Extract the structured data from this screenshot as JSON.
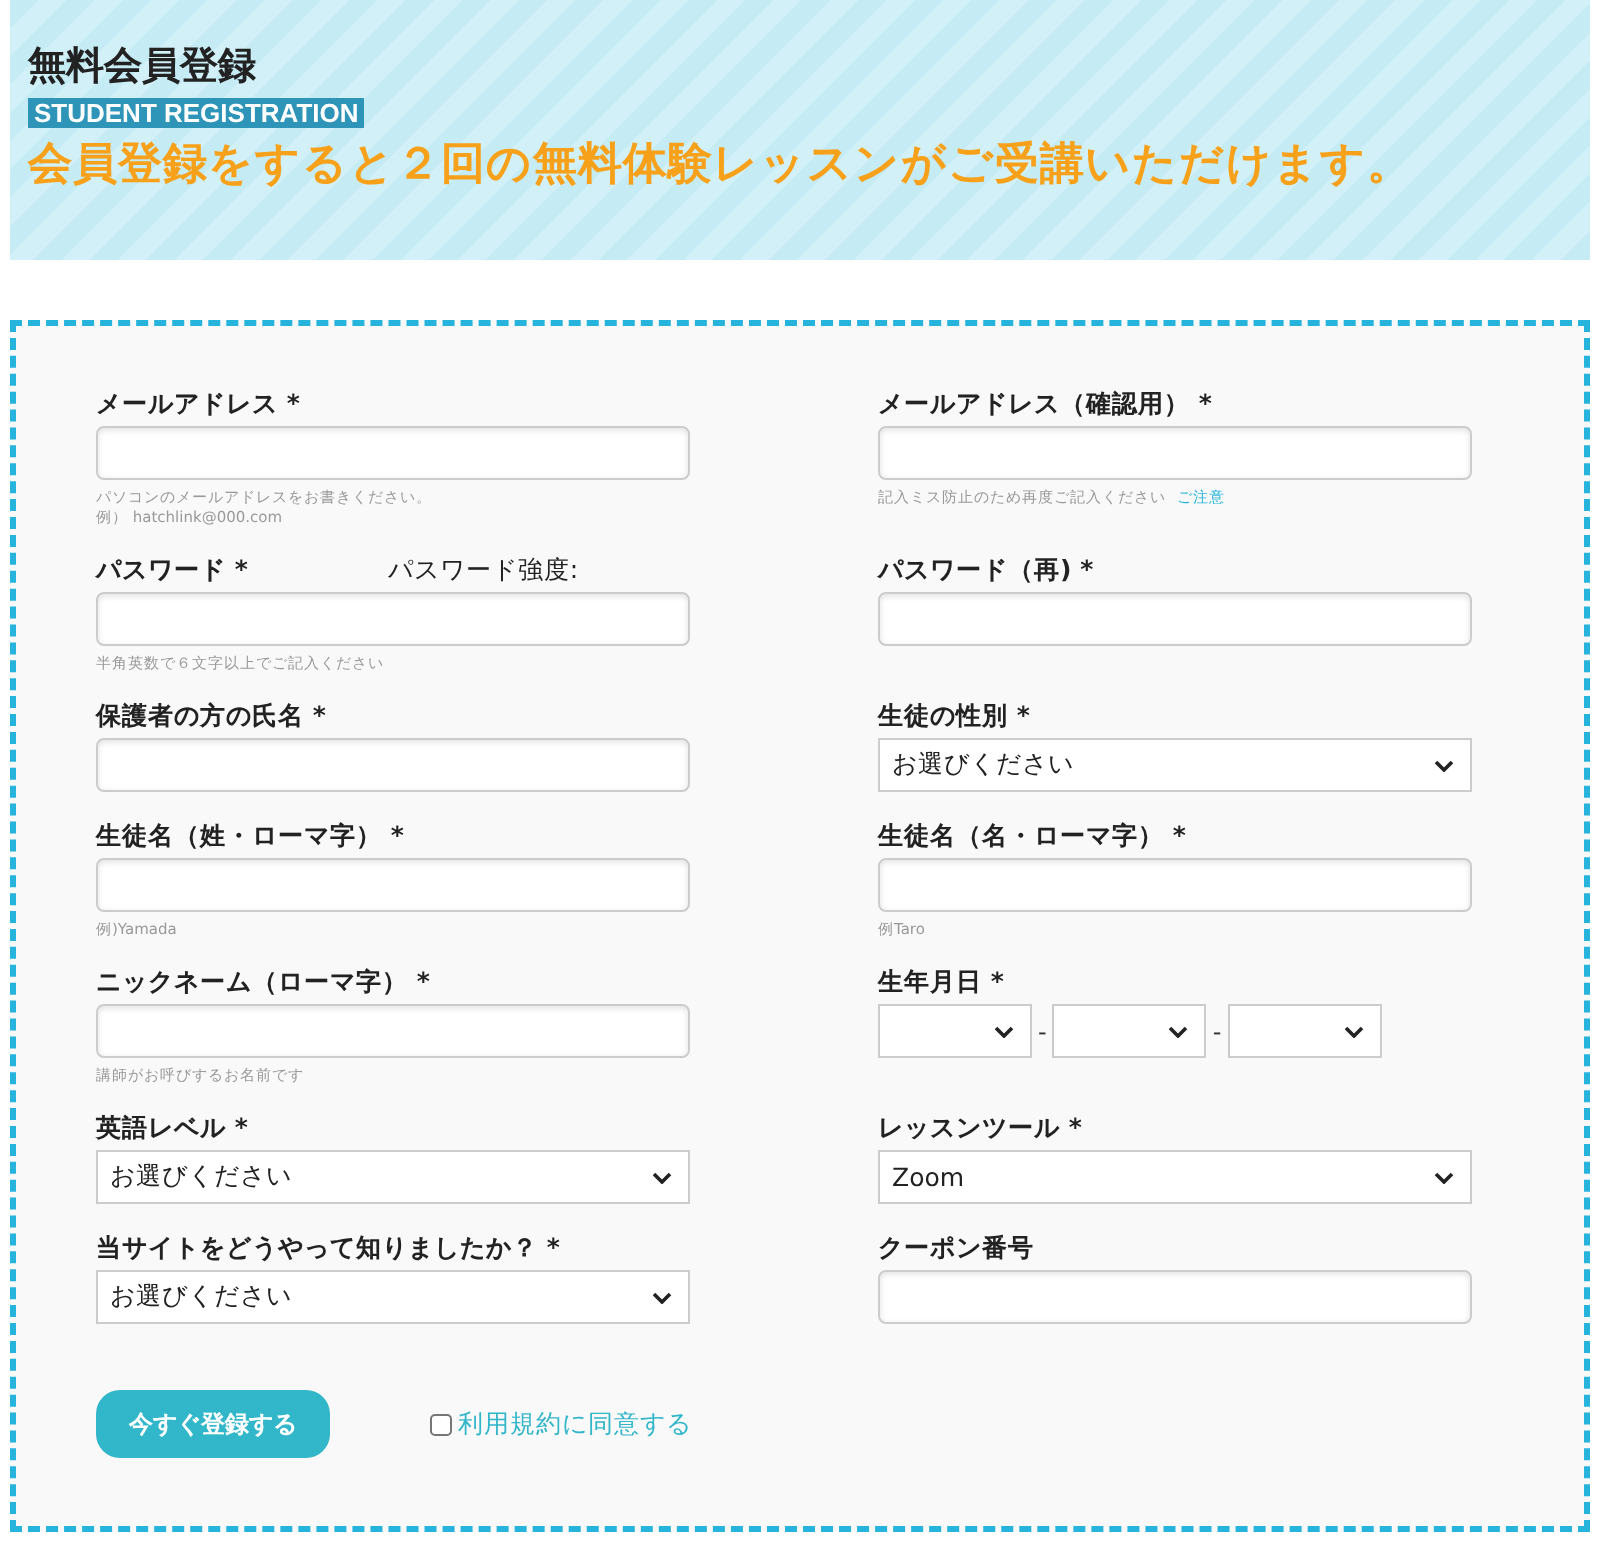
{
  "header": {
    "title": "無料会員登録",
    "subtitle": "STUDENT REGISTRATION",
    "tagline": "会員登録をすると２回の無料体験レッスンがご受講いただけます。"
  },
  "form": {
    "fields": [
      {
        "kind": "text",
        "label": "メールアドレス *",
        "hints": [
          {
            "text": "パソコンのメールアドレスをお書きください。"
          },
          {
            "text": "例） hatchlink@000.com"
          }
        ]
      },
      {
        "kind": "text",
        "label": "メールアドレス（確認用） *",
        "hints": [
          {
            "text": "記入ミス防止のため再度ご記入ください",
            "link": "ご注意"
          }
        ]
      },
      {
        "kind": "text",
        "label": "パスワード *",
        "aside": "パスワード強度:",
        "hints": [
          {
            "text": "半角英数で６文字以上でご記入ください"
          }
        ]
      },
      {
        "kind": "text",
        "label": "パスワード（再) *"
      },
      {
        "kind": "text",
        "label": "保護者の方の氏名 *"
      },
      {
        "kind": "select",
        "label": "生徒の性別 *",
        "value": "お選びください"
      },
      {
        "kind": "text",
        "label": "生徒名（姓・ローマ字） *",
        "hints": [
          {
            "text": "例)Yamada"
          }
        ]
      },
      {
        "kind": "text",
        "label": "生徒名（名・ローマ字） *",
        "hints": [
          {
            "text": "例Taro"
          }
        ]
      },
      {
        "kind": "text",
        "label": "ニックネーム（ローマ字） *",
        "hints": [
          {
            "text": "講師がお呼びするお名前です"
          }
        ]
      },
      {
        "kind": "date",
        "label": "生年月日 *",
        "separators": [
          "-",
          "-"
        ]
      },
      {
        "kind": "select",
        "label": "英語レベル *",
        "value": "お選びください"
      },
      {
        "kind": "select",
        "label": "レッスンツール *",
        "value": "Zoom"
      },
      {
        "kind": "select",
        "label": "当サイトをどうやって知りましたか？ *",
        "value": "お選びください"
      },
      {
        "kind": "text",
        "label": "クーポン番号"
      }
    ],
    "submit": "今すぐ登録する",
    "agree": {
      "label": "利用規約に同意する",
      "checked": false
    }
  }
}
